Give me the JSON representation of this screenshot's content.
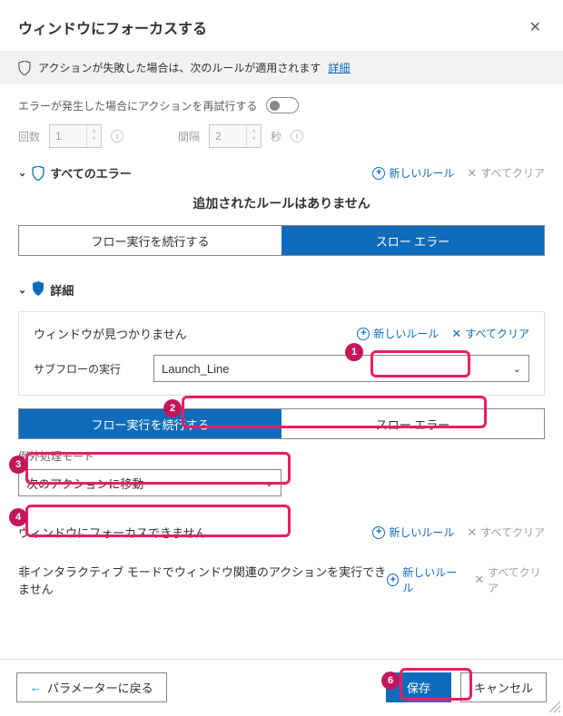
{
  "title": "ウィンドウにフォーカスする",
  "banner": {
    "text": "アクションが失敗した場合は、次のルールが適用されます",
    "link": "詳細"
  },
  "retry": {
    "label": "エラーが発生した場合にアクションを再試行する",
    "times_label": "回数",
    "times_value": "1",
    "interval_label": "間隔",
    "interval_value": "2",
    "seconds_label": "秒"
  },
  "all_errors": {
    "title": "すべてのエラー",
    "new_rule": "新しいルール",
    "clear_all": "すべてクリア",
    "no_rules": "追加されたルールはありません",
    "continue": "フロー実行を続行する",
    "throw": "スロー エラー"
  },
  "detail": {
    "title": "詳細",
    "window_not_found": "ウィンドウが見つかりません",
    "new_rule": "新しいルール",
    "clear_all": "すべてクリア",
    "subflow_label": "サブフローの実行",
    "subflow_value": "Launch_Line",
    "continue": "フロー実行を続行する",
    "throw": "スロー エラー",
    "mode_label": "例外処理モード",
    "mode_value": "次のアクションに移動",
    "cannot_focus": "ウィンドウにフォーカスできません",
    "noninteractive": "非インタラクティブ モードでウィンドウ関連のアクションを実行できません"
  },
  "footer": {
    "back": "パラメーターに戻る",
    "save": "保存",
    "cancel": "キャンセル"
  },
  "badges": {
    "b1": "1",
    "b2": "2",
    "b3": "3",
    "b4": "4",
    "b6": "6"
  }
}
